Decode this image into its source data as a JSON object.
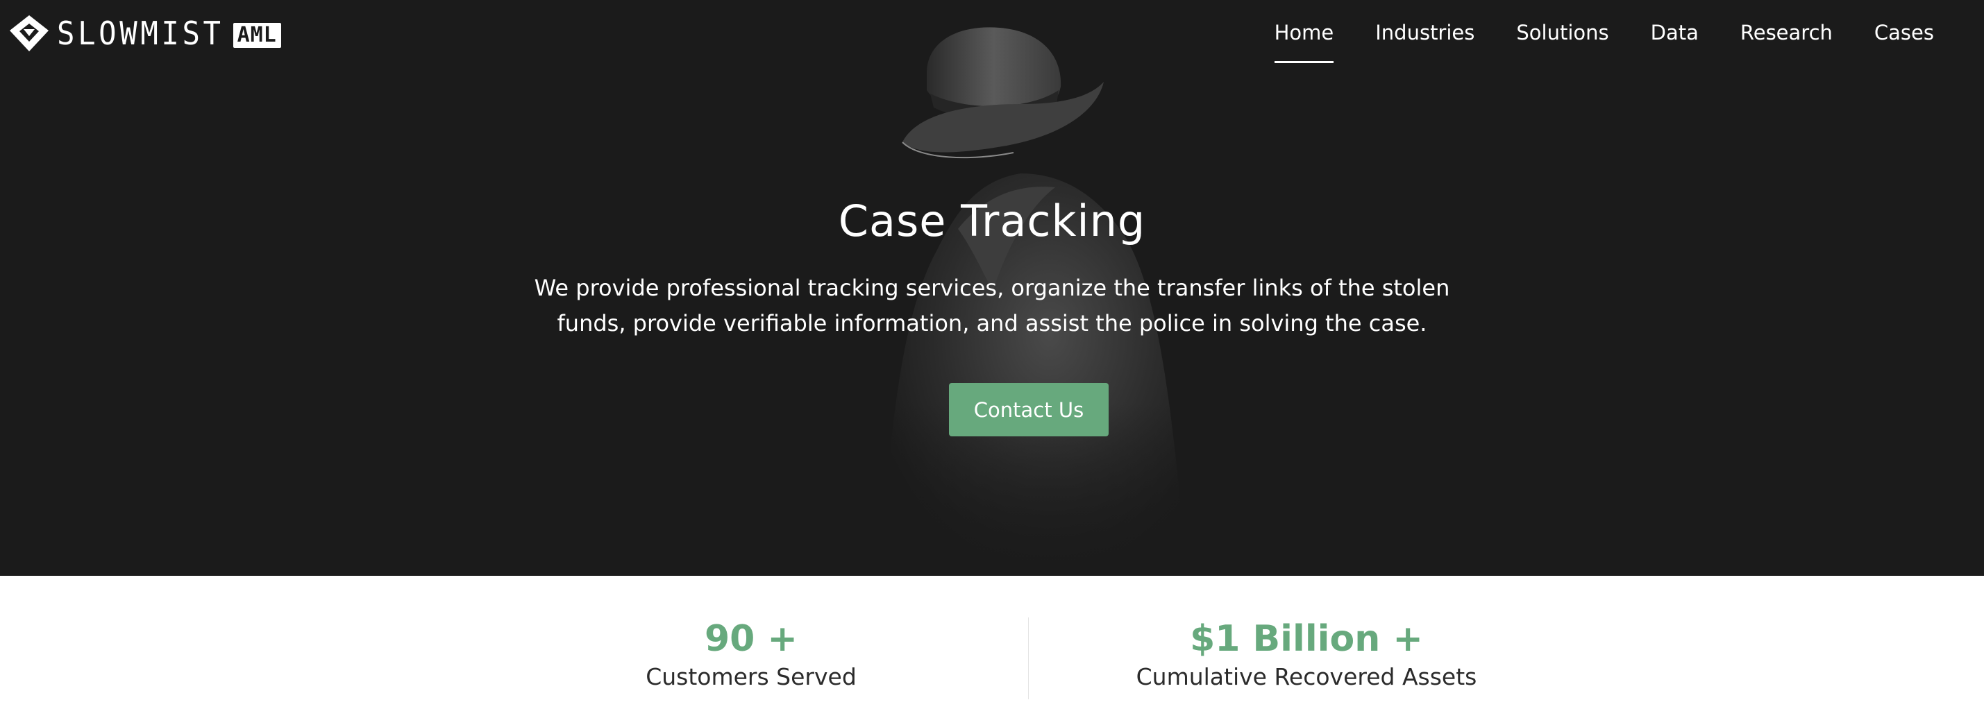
{
  "brand": {
    "name": "SLOWMIST",
    "badge": "AML"
  },
  "nav": {
    "items": [
      {
        "label": "Home",
        "active": true
      },
      {
        "label": "Industries",
        "active": false
      },
      {
        "label": "Solutions",
        "active": false
      },
      {
        "label": "Data",
        "active": false
      },
      {
        "label": "Research",
        "active": false
      },
      {
        "label": "Cases",
        "active": false
      }
    ]
  },
  "hero": {
    "title": "Case Tracking",
    "description": "We provide professional tracking services, organize the transfer links of the stolen funds, provide verifiable information, and assist the police in solving the case.",
    "cta_label": "Contact Us"
  },
  "stats": [
    {
      "value": "90 +",
      "label": "Customers Served"
    },
    {
      "value": "$1 Billion +",
      "label": "Cumulative Recovered Assets"
    }
  ],
  "colors": {
    "hero_background": "#1b1b1b",
    "accent_green": "#67a97d",
    "text_dark": "#2b2b2b"
  }
}
